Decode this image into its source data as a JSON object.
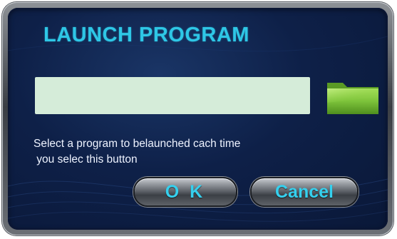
{
  "dialog": {
    "title": "LAUNCH PROGRAM",
    "path_field": {
      "value": "",
      "placeholder": ""
    },
    "folder_icon": "folder-icon",
    "hint_line1": "Select a program to belaunched cach time",
    "hint_line2": " you selec this button",
    "ok_label": "O K",
    "cancel_label": "Cancel"
  },
  "colors": {
    "title": "#2ec7e6",
    "panel_bg": "#0e2048",
    "field_bg": "#d5ecd9",
    "folder": "#7cc23a",
    "button_text": "#35d0ee"
  }
}
